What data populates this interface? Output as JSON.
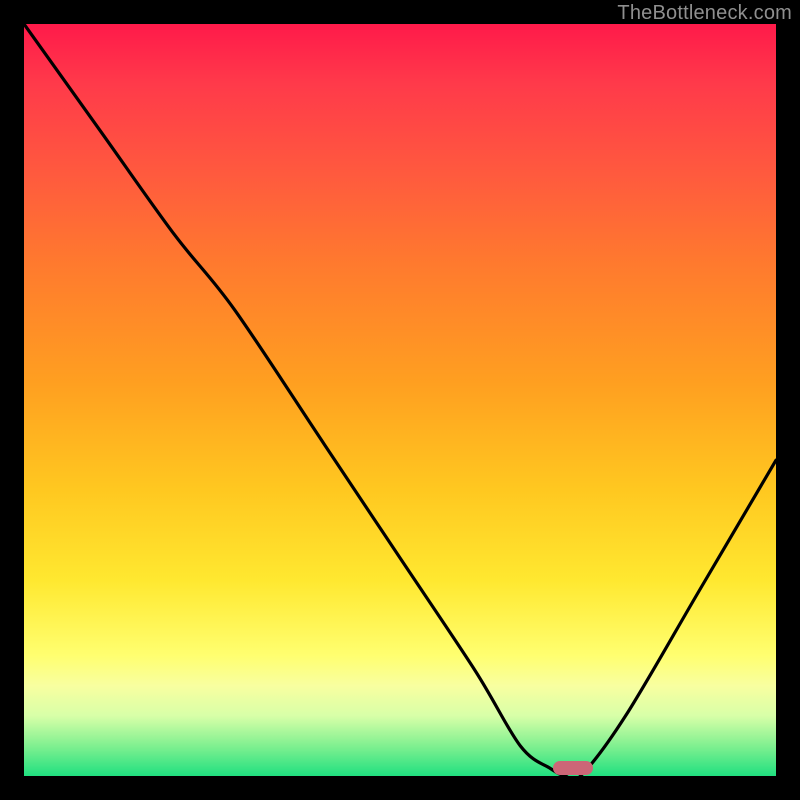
{
  "watermark": "TheBottleneck.com",
  "colors": {
    "background": "#000000",
    "curve": "#000000",
    "marker": "#cc6677",
    "watermark": "#8f8f8f",
    "gradient_top": "#ff1a4a",
    "gradient_bottom": "#20e080"
  },
  "chart_data": {
    "type": "line",
    "title": "",
    "xlabel": "",
    "ylabel": "",
    "xlim": [
      0,
      100
    ],
    "ylim": [
      0,
      100
    ],
    "grid": false,
    "series": [
      {
        "name": "curve",
        "x": [
          0,
          10,
          20,
          28,
          40,
          50,
          60,
          66,
          70,
          72,
          74,
          80,
          90,
          100
        ],
        "values": [
          100,
          86,
          72,
          62,
          44,
          29,
          14,
          4,
          1,
          0,
          0,
          8,
          25,
          42
        ]
      }
    ],
    "annotations": [
      {
        "type": "marker",
        "shape": "pill",
        "x": 73,
        "y": 1
      }
    ]
  }
}
